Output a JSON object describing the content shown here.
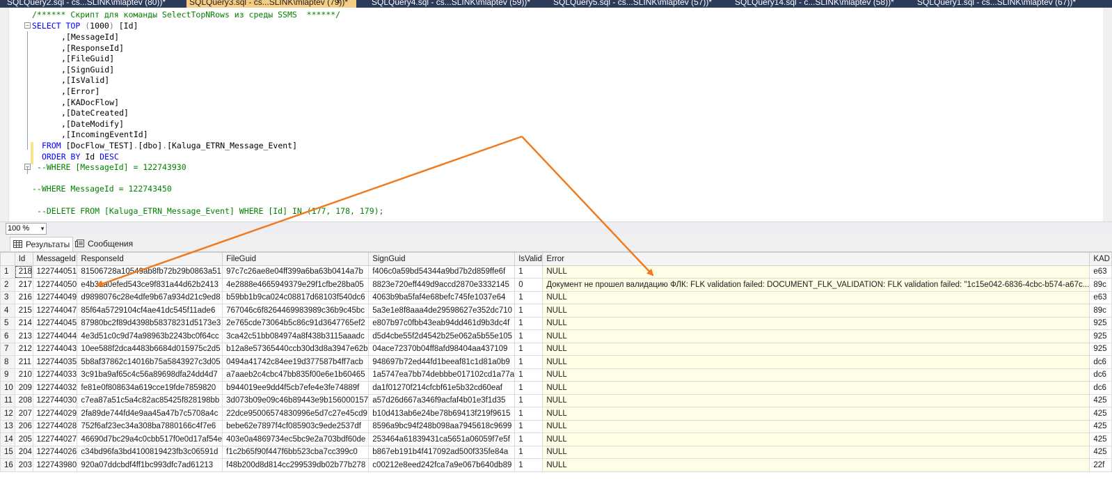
{
  "tabs": [
    {
      "label": "SQLQuery2.sql - cs...SLINK\\mlaptev (80))*"
    },
    {
      "label": "SQLQuery3.sql - cs...SLINK\\mlaptev (79))*"
    },
    {
      "label": "SQLQuery4.sql - cs...SLINK\\mlaptev (59))*"
    },
    {
      "label": "SQLQuery5.sql - cs...SLINK\\mlaptev (57))*"
    },
    {
      "label": "SQLQuery14.sql - c...SLINK\\mlaptev (58))*"
    },
    {
      "label": "SQLQuery1.sql - cs...SLINK\\mlaptev (67))*"
    }
  ],
  "tab_close_glyph": "×",
  "code": {
    "comment": "/****** Скрипт для команды SelectTopNRows из среды SSMS  ******/",
    "select_kw": "SELECT",
    "top_kw": "TOP",
    "top_paren_open": "(",
    "top_n": "1000",
    "top_paren_close": ")",
    "first_col": "[Id]",
    "columns": [
      ",[MessageId]",
      ",[ResponseId]",
      ",[FileGuid]",
      ",[SignGuid]",
      ",[IsValid]",
      ",[Error]",
      ",[KADocFlow]",
      ",[DateCreated]",
      ",[DateModify]",
      ",[IncomingEventId]"
    ],
    "from_kw": "FROM",
    "from_table_a": "[DocFlow_TEST]",
    "from_table_b": "[dbo]",
    "from_table_c": "[Kaluga_ETRN_Message_Event]",
    "dot": ".",
    "order_kw": "ORDER BY",
    "order_col": "Id",
    "desc_kw": "DESC",
    "where1": "--WHERE [MessageId] = 122743930",
    "where2": "--WHERE MessageId = 122743450",
    "delete": "--DELETE FROM [Kaluga_ETRN_Message_Event] WHERE [Id] IN (177, 178, 179);",
    "collapse_glyph": "−"
  },
  "zoom": {
    "value": "100 %",
    "arrow": "▼"
  },
  "result_tabs": [
    {
      "label": "Результаты"
    },
    {
      "label": "Сообщения"
    }
  ],
  "grid": {
    "columns": [
      "Id",
      "MessageId",
      "ResponseId",
      "FileGuid",
      "SignGuid",
      "IsValid",
      "Error",
      "KAD"
    ],
    "rows": [
      [
        "1",
        "218",
        "122744051",
        "81506728a10549ab8fb72b29b0863a51",
        "97c7c26ae8e04ff399a6ba63b0414a7b",
        "f406c0a59bd54344a9bd7b2d859ffe6f",
        "1",
        "NULL",
        "e63"
      ],
      [
        "2",
        "217",
        "122744050",
        "e4b31a0efed543ce9f831a44d62b2413",
        "4e2888e4665949379e29f1cfbe28ba05",
        "8823e720eff449d9accd2870e3332145",
        "0",
        "Документ не прошел валидацию ФЛК: FLK validation failed: DOCUMENT_FLK_VALIDATION: FLK validation failed: \"1c15e042-6836-4cbc-b574-a67c...",
        "89c"
      ],
      [
        "3",
        "216",
        "122744049",
        "d9898076c28e4dfe9b67a934d21c9ed8",
        "b59bb1b9ca024c08817d68103f540dc6",
        "4063b9ba5faf4e68befc745fe1037e64",
        "1",
        "NULL",
        "e63"
      ],
      [
        "4",
        "215",
        "122744047",
        "85f64a5729104cf4ae41dc545f11ade6",
        "767046c6f8264469983989c36b9c45bc",
        "5a3e1e8f8aaa4de29598627e352dc710",
        "1",
        "NULL",
        "89c"
      ],
      [
        "5",
        "214",
        "122744045",
        "87980bc2f89d4398b58378231d5173e3",
        "2e765cde73064b5c86c91d3647765ef2",
        "e807b97c0fbb43eab94dd461d9b3dc4f",
        "1",
        "NULL",
        "925"
      ],
      [
        "6",
        "213",
        "122744044",
        "4e3d51c0c9d74a98963b2243bc0f64cc",
        "3ca42c51bb084974a8f438b3115aaadc",
        "d5d4cbe55f2d4542b25e062a5b55e105",
        "1",
        "NULL",
        "925"
      ],
      [
        "7",
        "212",
        "122744043",
        "10ee588f2dca4483b6684d015975c2d5",
        "b12a8e57365440ccb30d3d8a3947e62b",
        "04ace72370b04ff8afd98404aa437109",
        "1",
        "NULL",
        "925"
      ],
      [
        "8",
        "211",
        "122744035",
        "5b8af37862c14016b75a5843927c3d05",
        "0494a41742c84ee19d377587b4ff7acb",
        "948697b72ed44fd1beeaf81c1d81a0b9",
        "1",
        "NULL",
        "dc6"
      ],
      [
        "9",
        "210",
        "122744033",
        "3c91ba9af65c4c56a89698dfa24dd4d7",
        "a7aaeb2c4cbc47bb835f00e6e1b60465",
        "1a5747ea7bb74debbbe017102cd1a77a",
        "1",
        "NULL",
        "dc6"
      ],
      [
        "10",
        "209",
        "122744032",
        "fe81e0f808634a619cce19fde7859820",
        "b944019ee9dd4f5cb7efe4e3fe74889f",
        "da1f01270f214cfcbf61e5b32cd60eaf",
        "1",
        "NULL",
        "dc6"
      ],
      [
        "11",
        "208",
        "122744030",
        "c7ea87a51c5a4c82ac85425f828198bb",
        "3d073b09e09c46b89443e9b156000157",
        "a57d26d667a346f9acfaf4b01e3f1d35",
        "1",
        "NULL",
        "425"
      ],
      [
        "12",
        "207",
        "122744029",
        "2fa89de744fd4e9aa45a47b7c5708a4c",
        "22dce95006574830996e5d7c27e45cd9",
        "b10d413ab6e24be78b69413f219f9615",
        "1",
        "NULL",
        "425"
      ],
      [
        "13",
        "206",
        "122744028",
        "752f6af23ec34a308ba7880166c4f7e6",
        "bebe62e7897f4cf085903c9ede2537df",
        "8596a9bc94f248b098aa7945618c9699",
        "1",
        "NULL",
        "425"
      ],
      [
        "14",
        "205",
        "122744027",
        "46690d7bc29a4c0cbb517f0e0d17af54e",
        "403e0a4869734ec5bc9e2a703bdf60de",
        "253464a61839431ca5651a06059f7e5f",
        "1",
        "NULL",
        "425"
      ],
      [
        "15",
        "204",
        "122744026",
        "c34bd96fa3bd4100819423fb3c06591d",
        "f1c2b65f90f447f6bb523cba7cc399c0",
        "b867eb191b4f417092ad500f335fe84a",
        "1",
        "NULL",
        "425"
      ],
      [
        "16",
        "203",
        "122743980",
        "920a07ddcbdf4ff1bc993dfc7ad61213",
        "f48b200d8d814cc299539db02b77b278",
        "c00212e8eed242fca7a9e067b640db89",
        "1",
        "NULL",
        "22f"
      ]
    ]
  },
  "annotation_color": "#f07b1e"
}
